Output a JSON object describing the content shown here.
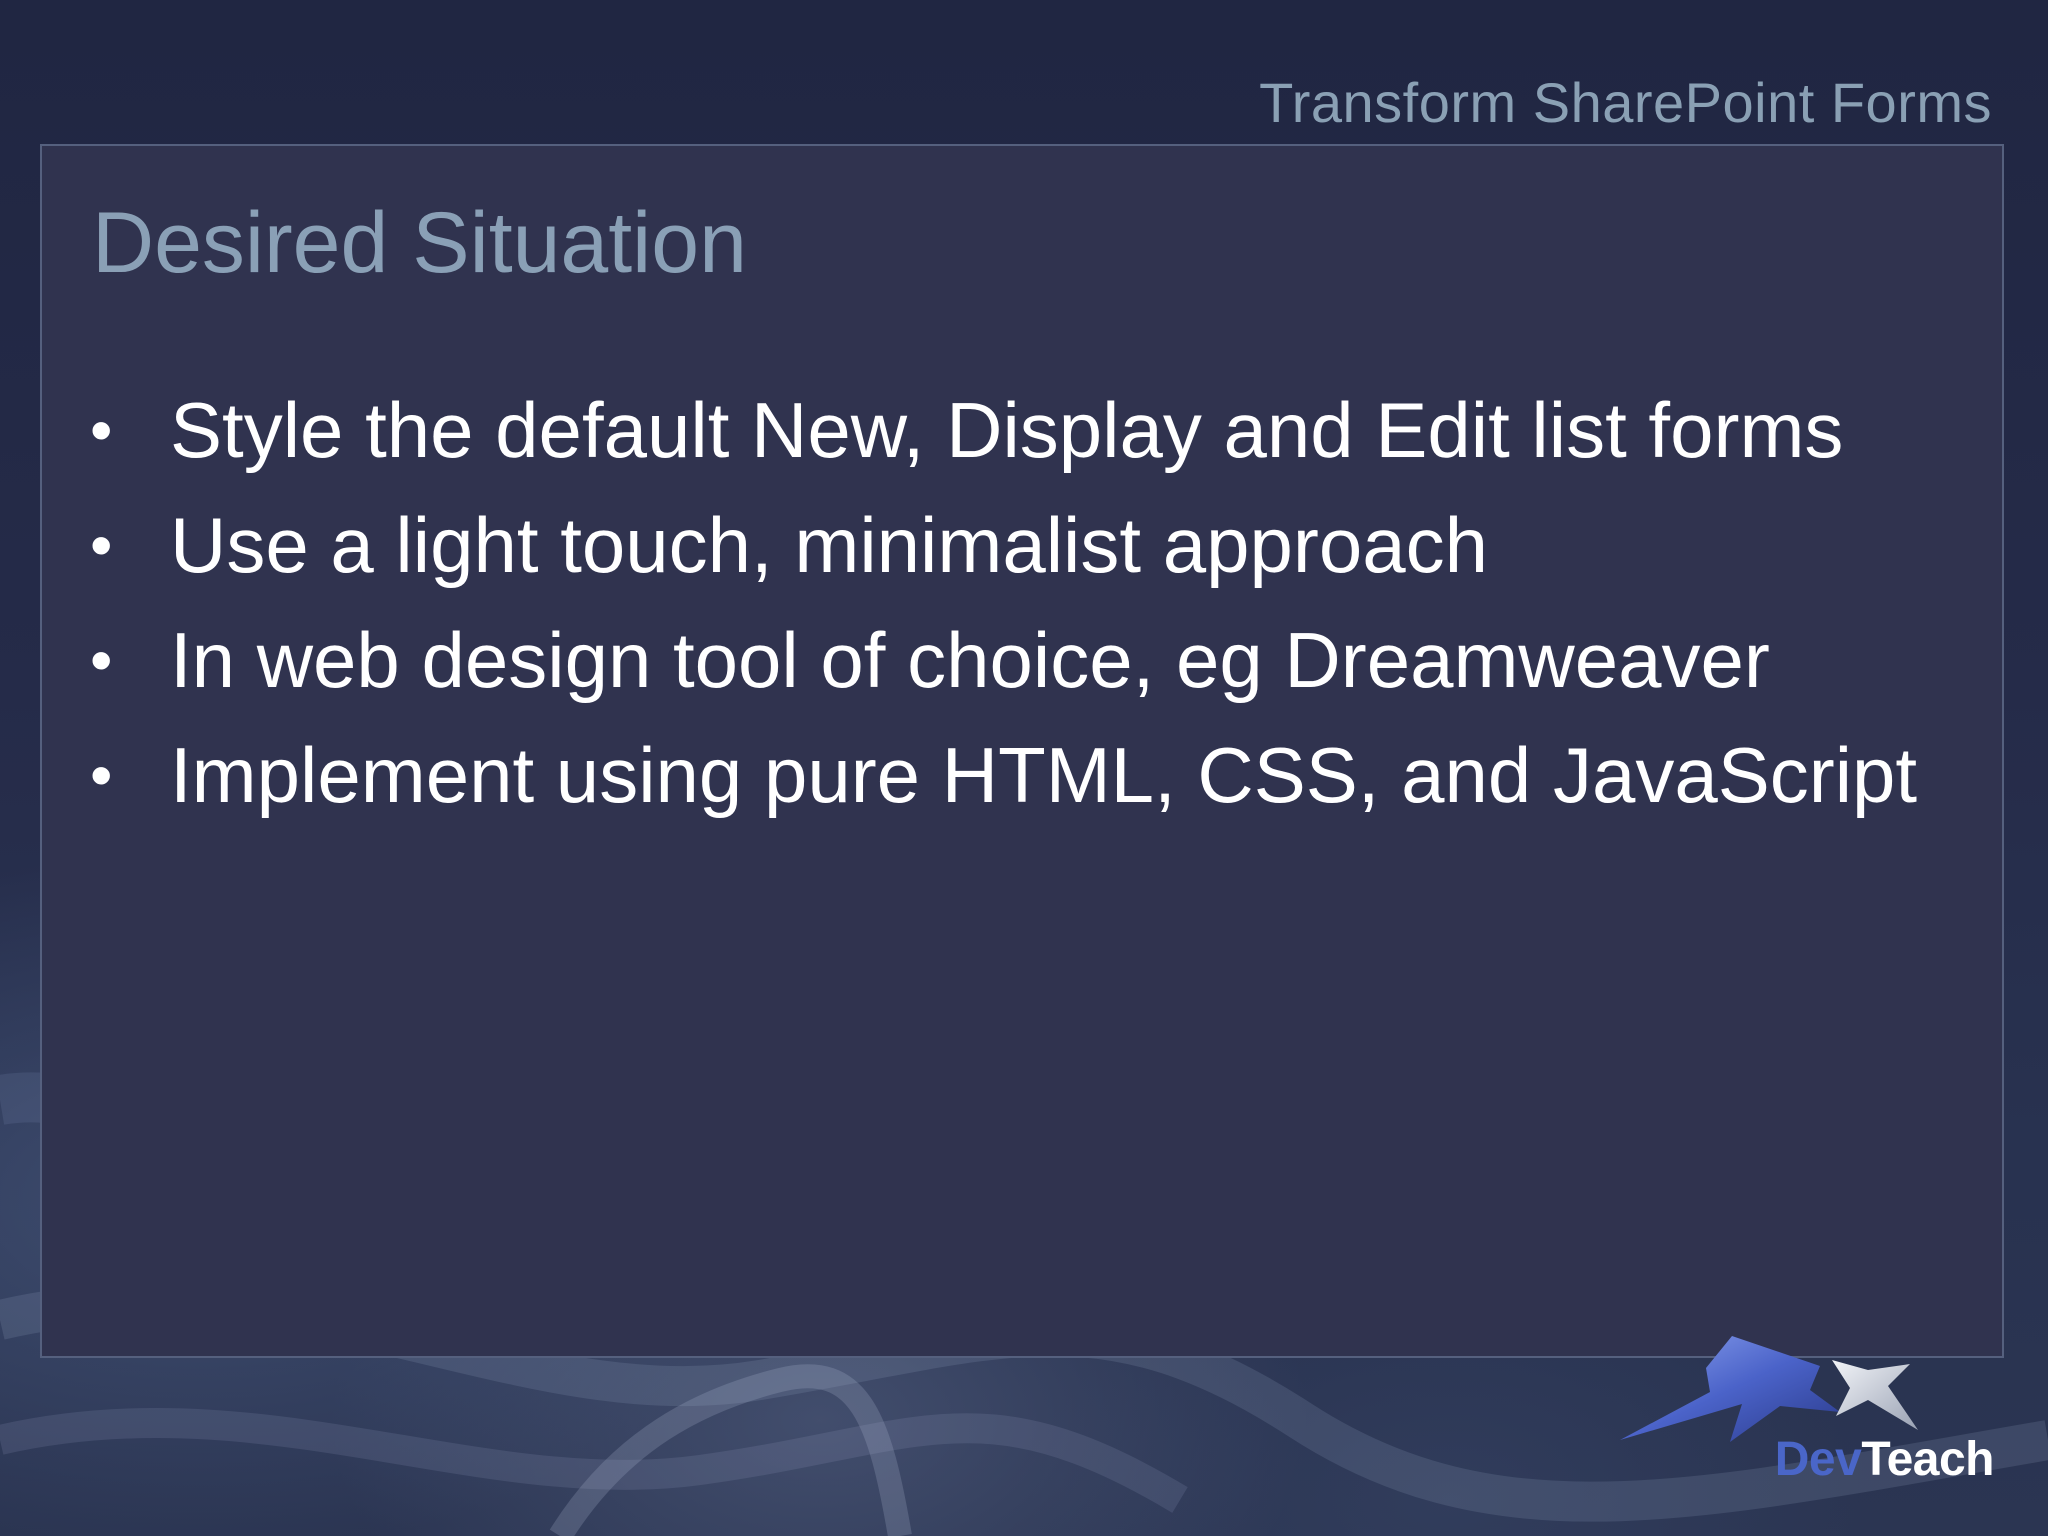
{
  "header": {
    "title": "Transform SharePoint Forms"
  },
  "slide": {
    "title": "Desired Situation",
    "bullet_symbol": "•",
    "bullets": [
      "Style the default New, Display and Edit list forms",
      "Use a light touch, minimalist approach",
      "In web design tool of choice, eg Dreamweaver",
      "Implement using pure HTML, CSS, and JavaScript"
    ]
  },
  "logo": {
    "part1": "Dev",
    "part2": "Teach"
  },
  "colors": {
    "background": "#252b49",
    "panel": "#30334f",
    "panel_border": "#55607e",
    "title": "#8aa0b6",
    "body_text": "#ffffff",
    "logo_blue": "#4a66c8"
  }
}
